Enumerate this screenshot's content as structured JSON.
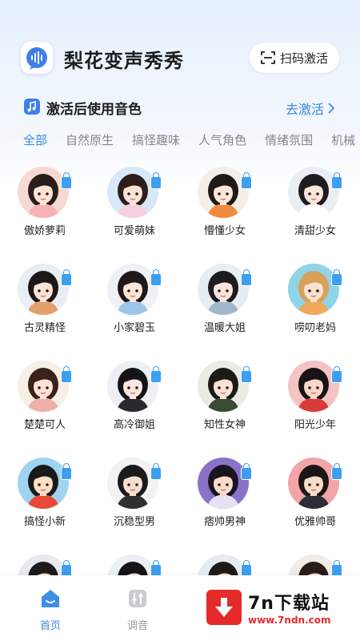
{
  "header": {
    "app_title": "梨花变声秀秀",
    "scan_label": "扫码激活"
  },
  "section": {
    "title": "激活后使用音色",
    "activate_label": "去激活"
  },
  "tabs": [
    "全部",
    "自然原生",
    "搞怪趣味",
    "人气角色",
    "情绪氛围",
    "机械"
  ],
  "voices": [
    {
      "name": "傲娇萝莉",
      "bg": "#f6d9d2",
      "hair": "#2a1d1a",
      "skin": "#fde3d6",
      "cloth": "#f7b3b3"
    },
    {
      "name": "可爱萌妹",
      "bg": "#d9e8f7",
      "hair": "#2b1e1b",
      "skin": "#fde3d6",
      "cloth": "#f8cfe0"
    },
    {
      "name": "懵懂少女",
      "bg": "#f1efe8",
      "hair": "#1e1a18",
      "skin": "#fde6d8",
      "cloth": "#f08a3c"
    },
    {
      "name": "清甜少女",
      "bg": "#e9eef5",
      "hair": "#1f1c1f",
      "skin": "#fde6da",
      "cloth": "#ffffff"
    },
    {
      "name": "古灵精怪",
      "bg": "#e9eef5",
      "hair": "#1c1818",
      "skin": "#fde3d6",
      "cloth": "#e4a06a"
    },
    {
      "name": "小家碧玉",
      "bg": "#eef2f7",
      "hair": "#1f1a1a",
      "skin": "#fde5d8",
      "cloth": "#9bc6ea"
    },
    {
      "name": "温暖大姐",
      "bg": "#e9edf2",
      "hair": "#1d1b1e",
      "skin": "#fbe4dc",
      "cloth": "#9fb8c9"
    },
    {
      "name": "唠叨老妈",
      "bg": "#8fd4e8",
      "hair": "#d9a05a",
      "skin": "#fbe1cf",
      "cloth": "#f0a95a"
    },
    {
      "name": "楚楚可人",
      "bg": "#f7efe5",
      "hair": "#3a2218",
      "skin": "#fde3d6",
      "cloth": "#efb0a8"
    },
    {
      "name": "高冷御姐",
      "bg": "#eceff3",
      "hair": "#141416",
      "skin": "#fbe7e0",
      "cloth": "#2a2a2e"
    },
    {
      "name": "知性女神",
      "bg": "#e8ece4",
      "hair": "#1c1a16",
      "skin": "#fae2d4",
      "cloth": "#3b4a36"
    },
    {
      "name": "阳光少年",
      "bg": "#f4c3c3",
      "hair": "#1a1214",
      "skin": "#f9d7c6",
      "cloth": "#d83a3a"
    },
    {
      "name": "搞怪小新",
      "bg": "#9fd3ef",
      "hair": "#1a1a1a",
      "skin": "#fde0c4",
      "cloth": "#e84a3a"
    },
    {
      "name": "沉稳型男",
      "bg": "#f2f2f2",
      "hair": "#1a1a1a",
      "skin": "#f7dfd0",
      "cloth": "#303030"
    },
    {
      "name": "痞帅男神",
      "bg": "#8b72c9",
      "hair": "#1a1420",
      "skin": "#f6dcca",
      "cloth": "#e7e1f2"
    },
    {
      "name": "优雅帅哥",
      "bg": "#f1a5a8",
      "hair": "#1e1614",
      "skin": "#f7dcc8",
      "cloth": "#2d2d3a"
    },
    {
      "name": "",
      "bg": "#e6eaef",
      "hair": "#1d1a1a",
      "skin": "#f7dfd0",
      "cloth": "#ffffff"
    },
    {
      "name": "",
      "bg": "#eceff3",
      "hair": "#161416",
      "skin": "#f7dfd0",
      "cloth": "#ffffff"
    },
    {
      "name": "",
      "bg": "#e7ebef",
      "hair": "#1c1a1a",
      "skin": "#f7dfd0",
      "cloth": "#ffffff"
    },
    {
      "name": "",
      "bg": "#f1ece8",
      "hair": "#2a1c18",
      "skin": "#f7dfd0",
      "cloth": "#ffffff"
    }
  ],
  "bottom_nav": {
    "home_label": "首页",
    "tune_label": "调音"
  },
  "watermark": {
    "brand": "7n下载站",
    "url": "www.7ndn.com"
  },
  "colors": {
    "accent": "#3b8bdc",
    "lock": "#3d9ff0",
    "watermark_red": "#e52a2a"
  }
}
